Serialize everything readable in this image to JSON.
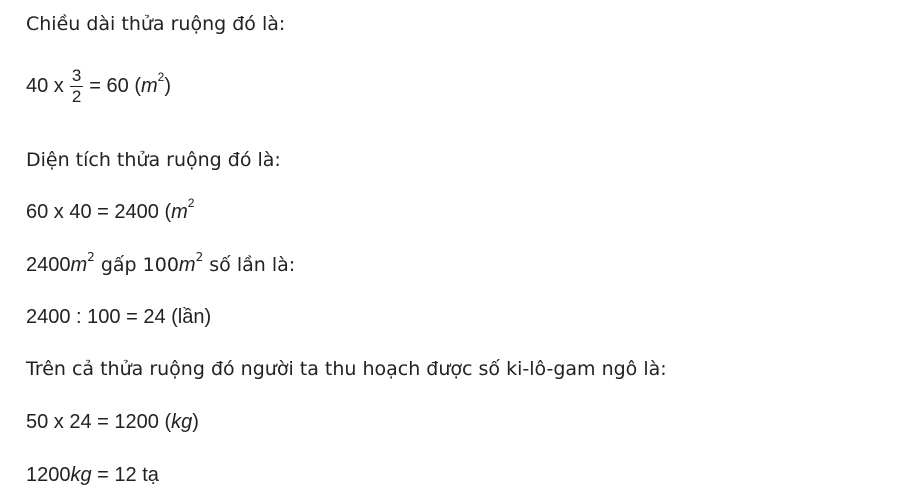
{
  "lines": {
    "l1": "Chiều dài thửa ruộng đó là:",
    "l2": {
      "pre": "40 x",
      "frac_num": "3",
      "frac_den": "2",
      "post": "= 60 (",
      "unit": "m",
      "exp": "2",
      "close": ")"
    },
    "l3": "Diện tích thửa ruộng đó là:",
    "l4": {
      "pre": "60 x 40 = 2400 (",
      "unit": "m",
      "exp": "2"
    },
    "l5": {
      "a": "2400",
      "unit1": "m",
      "exp1": "2",
      "mid": " gấp 100",
      "unit2": "m",
      "exp2": "2",
      "post": " số lần là:"
    },
    "l6": "2400 : 100 = 24 (lần)",
    "l7": "Trên cả thửa ruộng đó người ta thu hoạch được số ki-lô-gam ngô là:",
    "l8": {
      "pre": "50 x 24 = 1200 (",
      "unit": "kg",
      "close": ")"
    },
    "l9": {
      "pre": "1200",
      "unit": "kg",
      "post": " = 12 tạ"
    }
  }
}
